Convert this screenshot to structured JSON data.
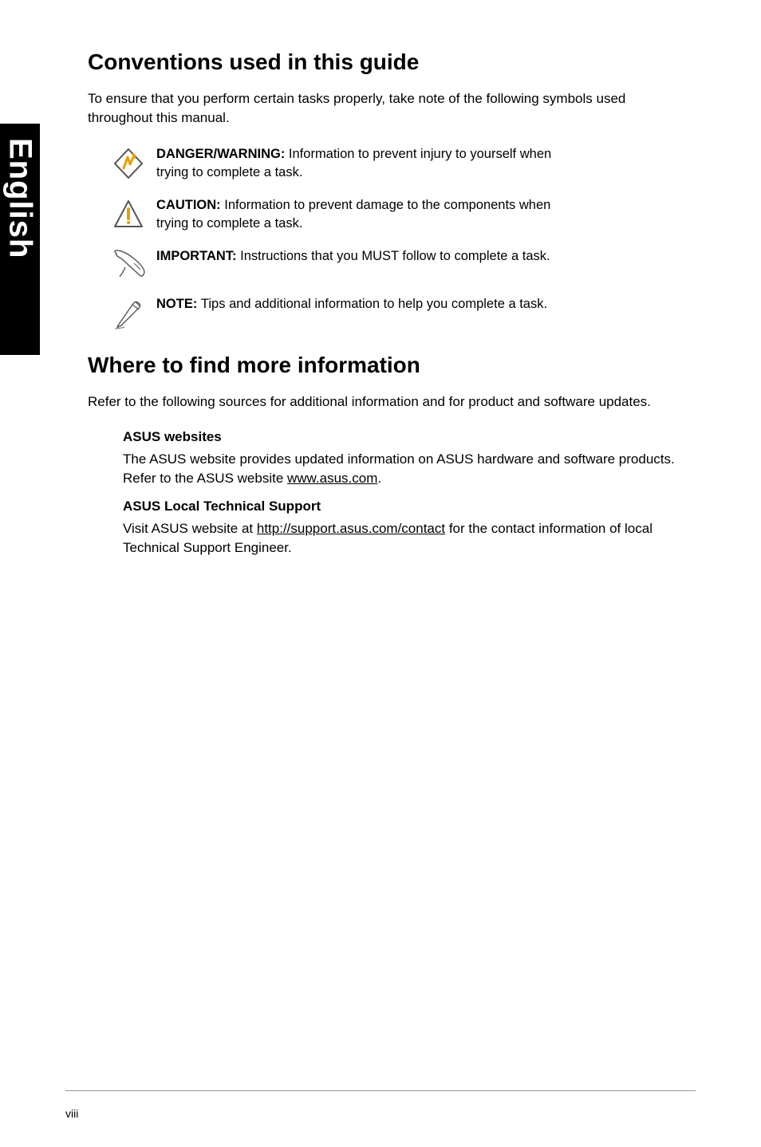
{
  "sideTab": "English",
  "heading1": "Conventions used in this guide",
  "intro1": "To ensure that you perform certain tasks properly, take note of the following symbols used throughout this manual.",
  "conventions": {
    "danger": {
      "label": "DANGER/WARNING: ",
      "text": "Information to prevent injury to yourself when trying to complete a task."
    },
    "caution": {
      "label": "CAUTION: ",
      "text": "Information to prevent damage to the components when trying to complete a task."
    },
    "important": {
      "label": "IMPORTANT: ",
      "text": "Instructions that you MUST follow to complete a task."
    },
    "note": {
      "label": "NOTE: ",
      "text": "Tips and additional information to help you complete a task."
    }
  },
  "heading2": "Where to find more information",
  "intro2": "Refer to the following sources for additional information and for product and software updates.",
  "asusWebsites": {
    "title": "ASUS websites",
    "bodyPre": "The ASUS website provides updated information on ASUS hardware and software products. Refer to the ASUS website ",
    "link": "www.asus.com",
    "bodyPost": "."
  },
  "localSupport": {
    "title": "ASUS Local Technical Support",
    "bodyPre": "Visit ASUS website at ",
    "link": "http://support.asus.com/contact",
    "bodyPost": " for the contact information of local Technical Support Engineer."
  },
  "pageNumber": "viii"
}
